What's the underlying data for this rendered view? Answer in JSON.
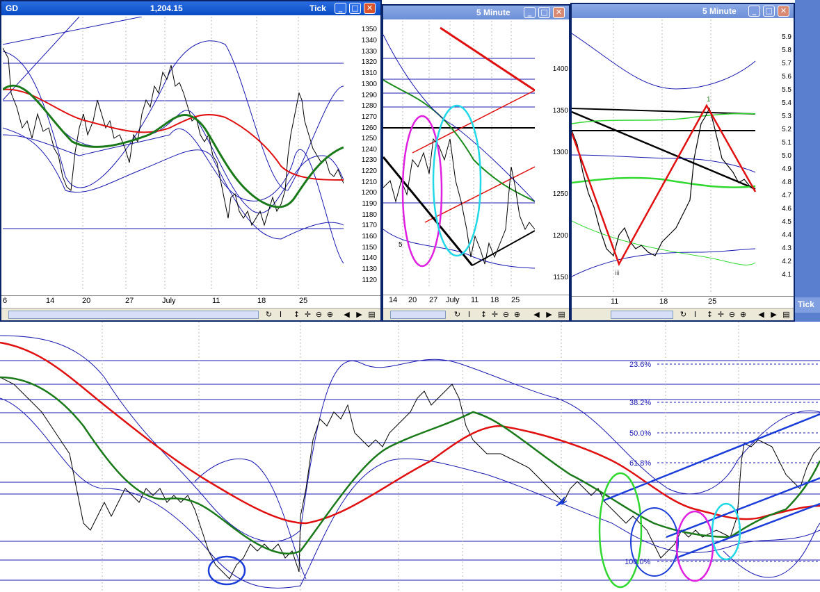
{
  "window_gd": {
    "symbol": "GD",
    "price": "1,204.15",
    "interval": "Tick",
    "y_ticks": [
      "1350",
      "1340",
      "1330",
      "1320",
      "1310",
      "1300",
      "1290",
      "1280",
      "1270",
      "1260",
      "1250",
      "1240",
      "1230",
      "1220",
      "1210",
      "1200",
      "1190",
      "1180",
      "1170",
      "1160",
      "1150",
      "1140",
      "1130",
      "1120"
    ],
    "dates": [
      "6",
      "14",
      "20",
      "27",
      "July",
      "11",
      "18",
      "25"
    ]
  },
  "window_mid": {
    "interval": "5 Minute",
    "y_ticks": [
      "1400",
      "1350",
      "1300",
      "1250",
      "1200",
      "1150"
    ],
    "dates": [
      "14",
      "20",
      "27",
      "July",
      "11",
      "18",
      "25"
    ],
    "wave_label": "5"
  },
  "window_right": {
    "interval": "5 Minute",
    "y_ticks": [
      "5.9",
      "5.8",
      "5.7",
      "5.6",
      "5.5",
      "5.4",
      "5.3",
      "5.2",
      "5.1",
      "5.0",
      "4.9",
      "4.8",
      "4.7",
      "4.6",
      "4.5",
      "4.4",
      "4.3",
      "4.2",
      "4.1"
    ],
    "dates": [
      "11",
      "18",
      "25"
    ],
    "peak_label": "1",
    "trough_label": "iii"
  },
  "background_window": {
    "label": "Tick"
  },
  "toolbar": {
    "refresh_icon": "↻",
    "cursor_icon": "I",
    "updown_icon": "↕",
    "move_icon": "✛",
    "zoomout_icon": "⊖",
    "zoomin_icon": "⊕",
    "left_icon": "◀",
    "right_icon": "▶",
    "menu_icon": "▤"
  },
  "main_chart": {
    "fib_levels": [
      "23.6%",
      "38.2%",
      "50.0%",
      "61.8%",
      "100.0%"
    ]
  },
  "colors": {
    "price": "#000000",
    "ma_fast": "#1a7a1a",
    "ma_slow": "#e01010",
    "bands": "#1818b0",
    "trend": "#1a3cd8",
    "title": "#0a4cc4"
  }
}
